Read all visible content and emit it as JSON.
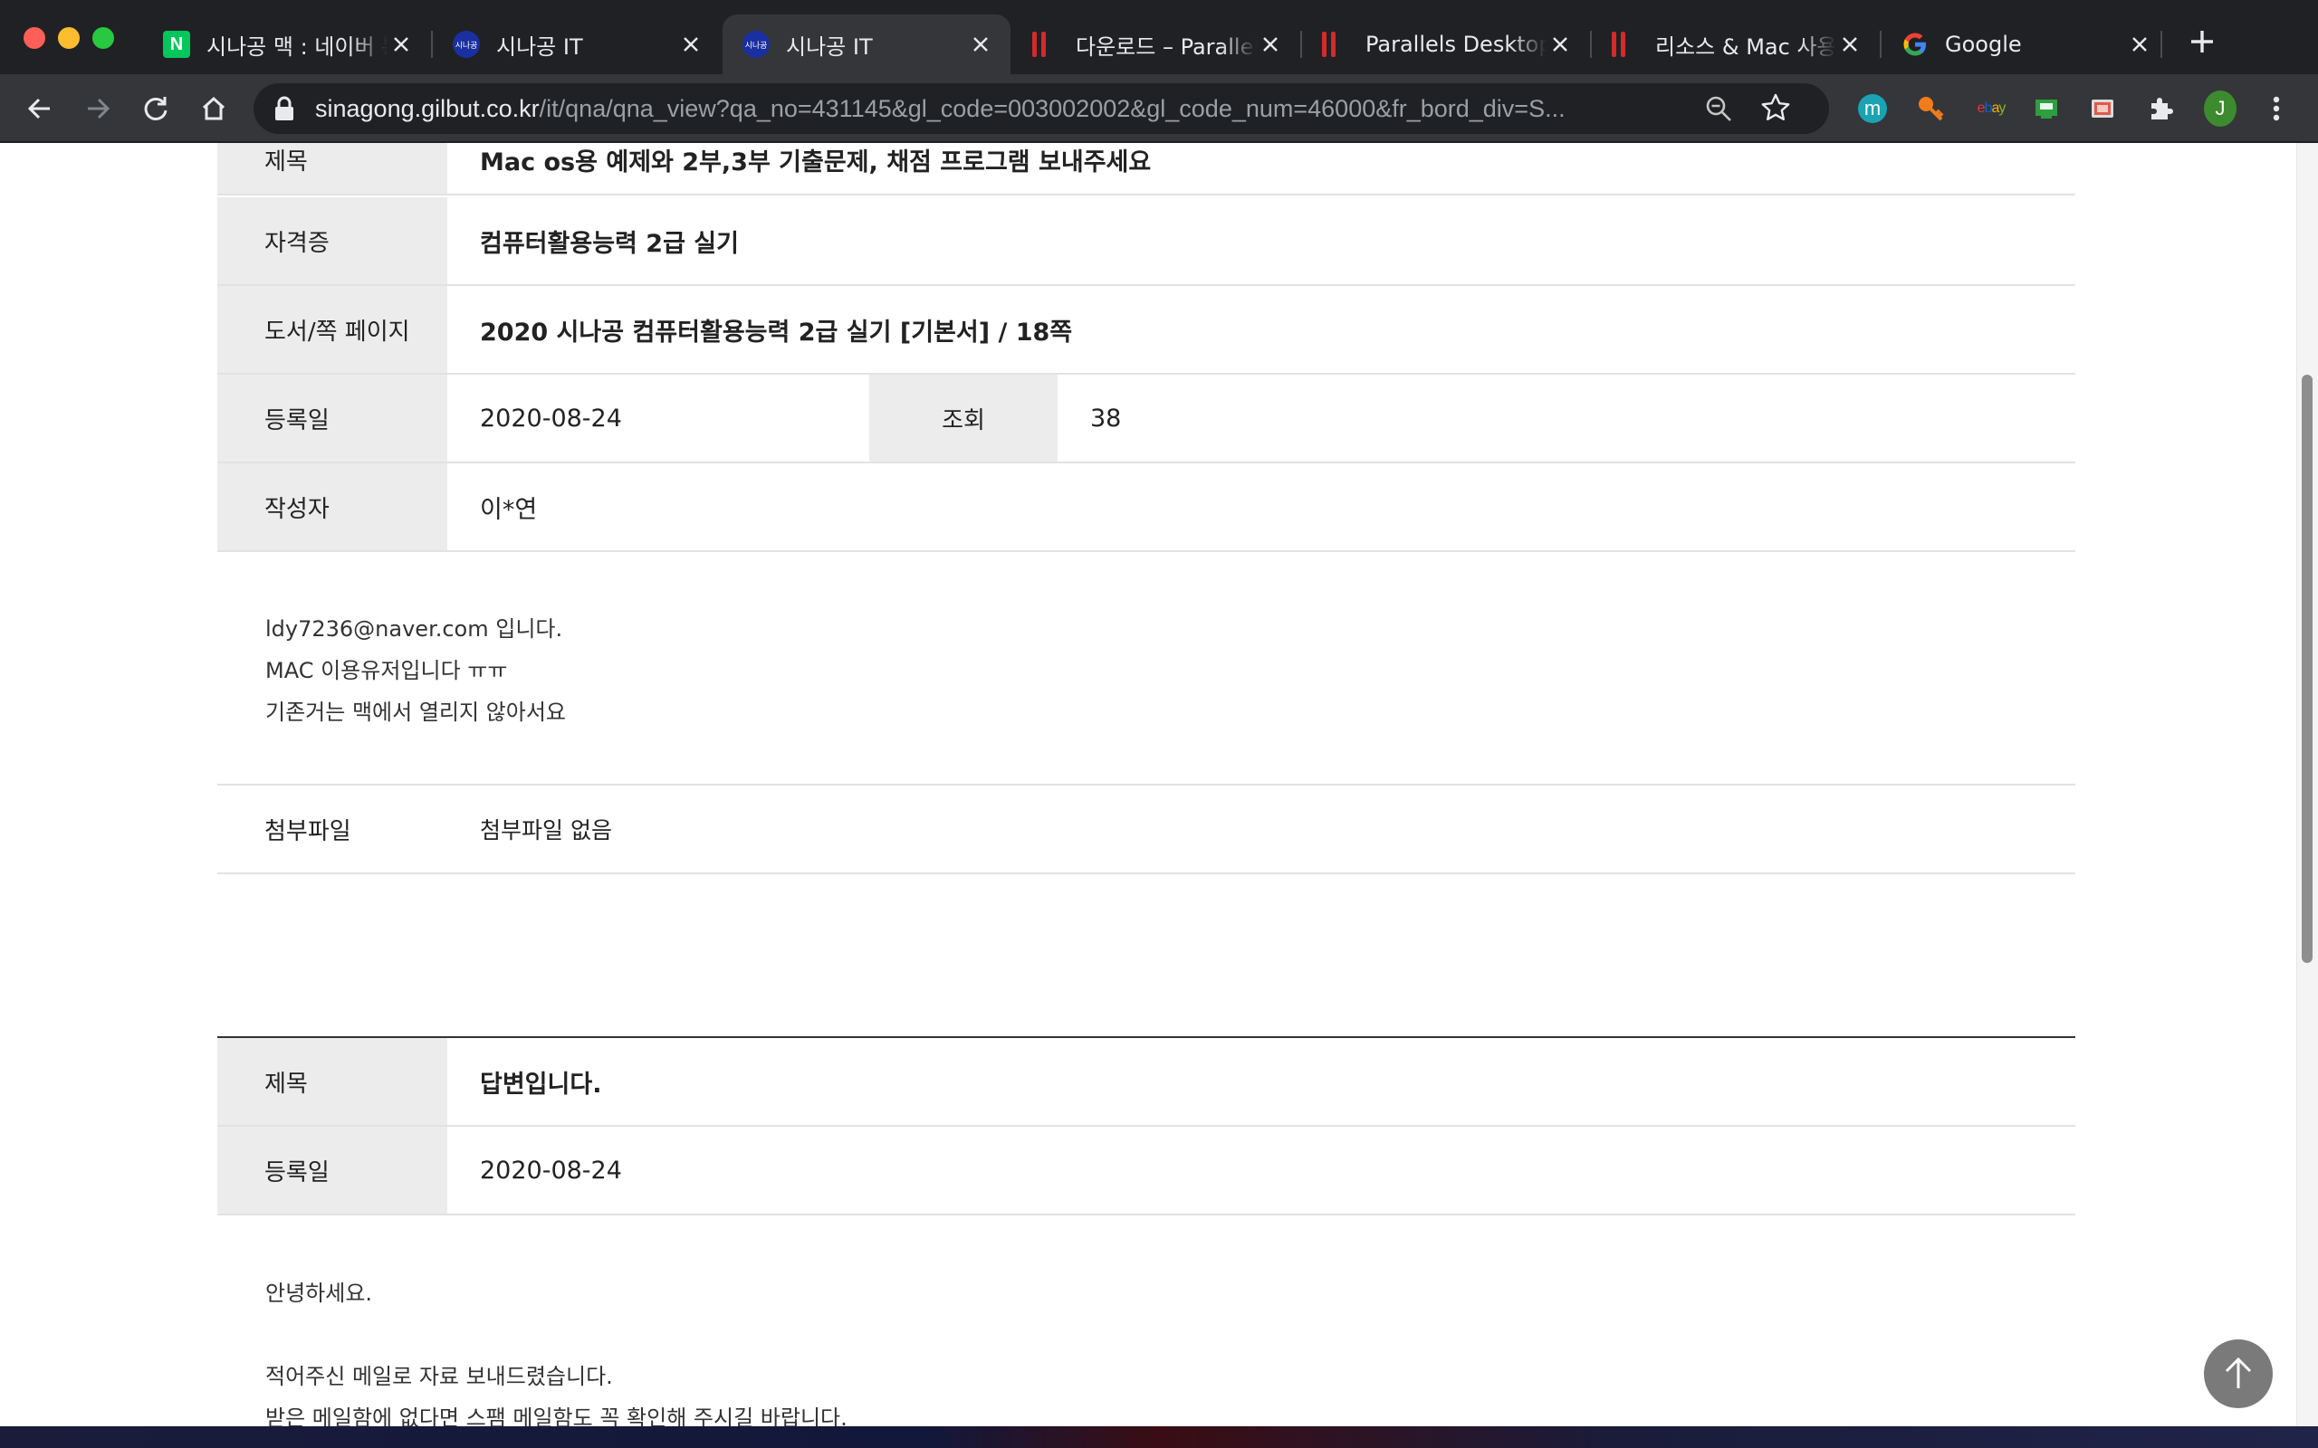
{
  "browser": {
    "tabs": [
      {
        "title": "시나공 맥 : 네이버 통합검색",
        "favicon": "naver-icon",
        "active": false
      },
      {
        "title": "시나공 IT",
        "favicon": "sinagong-icon",
        "active": false
      },
      {
        "title": "시나공 IT",
        "favicon": "sinagong-icon",
        "active": true
      },
      {
        "title": "다운로드 – Parallels",
        "favicon": "parallels-icon",
        "active": false
      },
      {
        "title": "Parallels Desktop",
        "favicon": "parallels-icon",
        "active": false
      },
      {
        "title": "리소스 & Mac 사용",
        "favicon": "parallels-icon",
        "active": false
      },
      {
        "title": "Google",
        "favicon": "google-icon",
        "active": false
      }
    ],
    "url_domain": "sinagong.gilbut.co.kr",
    "url_path": "/it/qna/qna_view?qa_no=431145&gl_code=003002002&gl_code_num=46000&fr_bord_div=S...",
    "extensions": [
      {
        "name": "m-extension-icon",
        "label": "m",
        "color": "#1aa3b3"
      },
      {
        "name": "key-extension-icon",
        "color": "#f07c1b"
      },
      {
        "name": "ebay-extension-icon",
        "label": "ebay"
      },
      {
        "name": "green-extension-icon",
        "color": "#2e9e3e"
      },
      {
        "name": "cast-extension-icon",
        "color": "#e05a4a"
      },
      {
        "name": "puzzle-extension-icon"
      }
    ],
    "profile_initial": "J",
    "profile_color": "#3d8b2f"
  },
  "question": {
    "subject_label": "제목",
    "subject": "Mac os용 예제와 2부,3부 기출문제, 채점 프로그램 보내주세요",
    "cert_label": "자격증",
    "cert": "컴퓨터활용능력 2급 실기",
    "book_label": "도서/쪽 페이지",
    "book": "2020 시나공 컴퓨터활용능력 2급 실기 [기본서] / 18쪽",
    "date_label": "등록일",
    "date": "2020-08-24",
    "views_label": "조회",
    "views": "38",
    "author_label": "작성자",
    "author": "이*연",
    "body": [
      "ldy7236@naver.com 입니다.",
      "MAC 이용유저입니다 ㅠㅠ",
      "기존거는 맥에서 열리지 않아서요"
    ],
    "attach_label": "첨부파일",
    "attach": "첨부파일 없음"
  },
  "answer": {
    "subject_label": "제목",
    "subject": "답변입니다.",
    "date_label": "등록일",
    "date": "2020-08-24",
    "body": [
      "안녕하세요.",
      "적어주신 메일로 자료 보내드렸습니다.",
      "받은 메일함에 없다면 스팸 메일함도 꼭 확인해 주시길 바랍니다."
    ]
  },
  "colors": {
    "link": "#114b9c",
    "label_bg": "#ececec",
    "tab_active": "#35363a",
    "tab_strip": "#202124"
  }
}
